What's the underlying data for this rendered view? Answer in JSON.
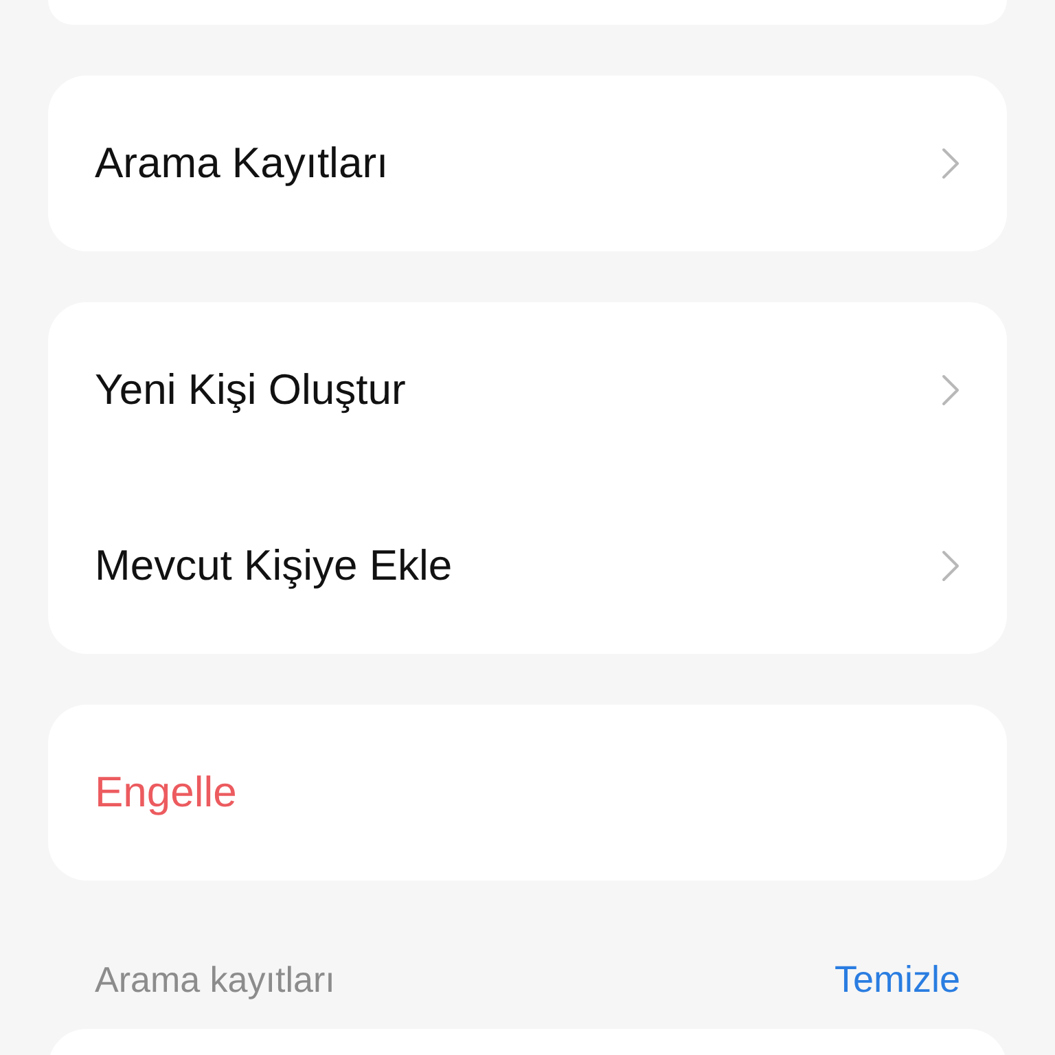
{
  "groups": [
    {
      "items": [
        {
          "label": "Arama Kayıtları",
          "kind": "link"
        }
      ]
    },
    {
      "items": [
        {
          "label": "Yeni Kişi Oluştur",
          "kind": "link"
        },
        {
          "label": "Mevcut Kişiye Ekle",
          "kind": "link"
        }
      ]
    },
    {
      "items": [
        {
          "label": "Engelle",
          "kind": "danger"
        }
      ]
    }
  ],
  "section": {
    "title": "Arama kayıtları",
    "action": "Temizle"
  }
}
